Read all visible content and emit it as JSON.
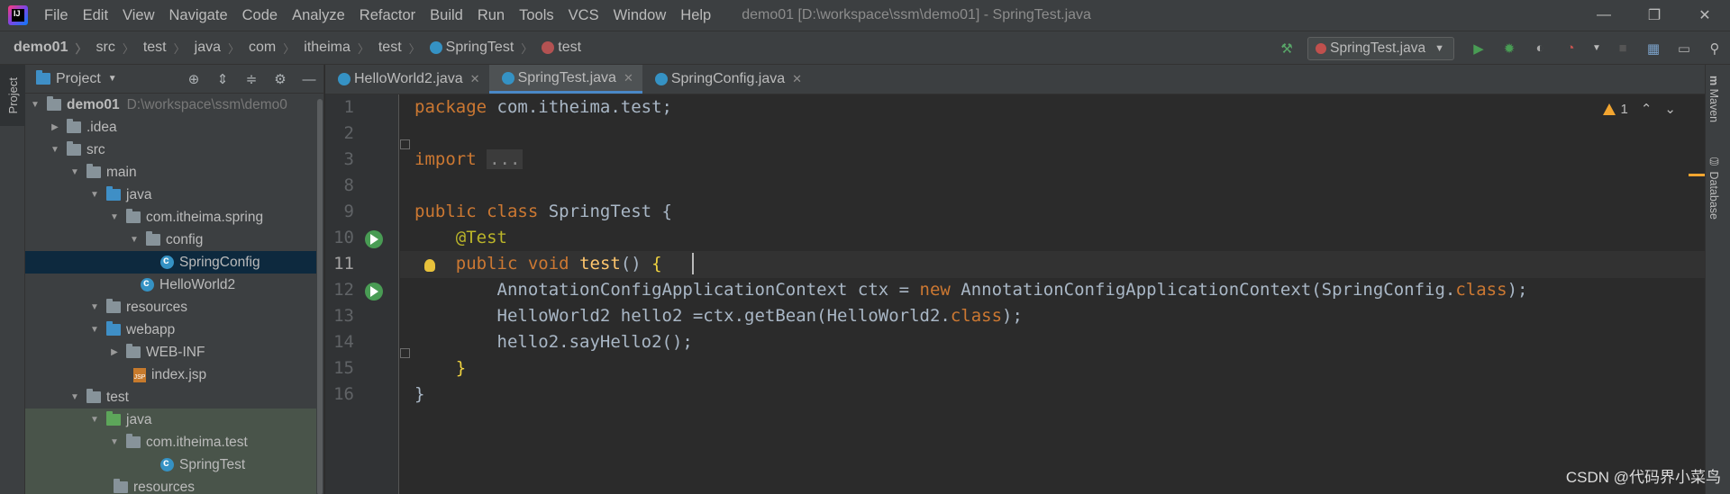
{
  "menubar": {
    "logo": "IJ",
    "items": [
      "File",
      "Edit",
      "View",
      "Navigate",
      "Code",
      "Analyze",
      "Refactor",
      "Build",
      "Run",
      "Tools",
      "VCS",
      "Window",
      "Help"
    ],
    "window_title": "demo01 [D:\\workspace\\ssm\\demo01] - SpringTest.java",
    "controls": {
      "minimize": "—",
      "restore": "❐",
      "close": "✕"
    }
  },
  "breadcrumb": {
    "items": [
      "demo01",
      "src",
      "test",
      "java",
      "com",
      "itheima",
      "test",
      "SpringTest",
      "test"
    ]
  },
  "toolbar": {
    "run_config": "SpringTest.java"
  },
  "left_stripe": {
    "project_tab": "Project"
  },
  "right_stripe": {
    "maven_tab": "Maven",
    "database_tab": "Database"
  },
  "project": {
    "title": "Project",
    "tree": [
      {
        "label": "demo01",
        "hint": "D:\\workspace\\ssm\\demo0",
        "depth": 0,
        "arrow": "down",
        "icon": "folder"
      },
      {
        "label": ".idea",
        "depth": 1,
        "arrow": "right",
        "icon": "folder"
      },
      {
        "label": "src",
        "depth": 1,
        "arrow": "down",
        "icon": "folder"
      },
      {
        "label": "main",
        "depth": 2,
        "arrow": "down",
        "icon": "folder"
      },
      {
        "label": "java",
        "depth": 3,
        "arrow": "down",
        "icon": "folder-blue"
      },
      {
        "label": "com.itheima.spring",
        "depth": 4,
        "arrow": "down",
        "icon": "folder"
      },
      {
        "label": "config",
        "depth": 5,
        "arrow": "down",
        "icon": "folder"
      },
      {
        "label": "SpringConfig",
        "depth": 6,
        "arrow": "none",
        "icon": "class"
      },
      {
        "label": "HelloWorld2",
        "depth": 5,
        "arrow": "none",
        "icon": "class"
      },
      {
        "label": "resources",
        "depth": 3,
        "arrow": "down",
        "icon": "folder"
      },
      {
        "label": "webapp",
        "depth": 3,
        "arrow": "down",
        "icon": "folder"
      },
      {
        "label": "WEB-INF",
        "depth": 4,
        "arrow": "right",
        "icon": "folder"
      },
      {
        "label": "index.jsp",
        "depth": 4,
        "arrow": "none",
        "icon": "jsp"
      },
      {
        "label": "test",
        "depth": 2,
        "arrow": "down",
        "icon": "folder"
      },
      {
        "label": "java",
        "depth": 3,
        "arrow": "down",
        "icon": "folder-green"
      },
      {
        "label": "com.itheima.test",
        "depth": 4,
        "arrow": "down",
        "icon": "folder"
      },
      {
        "label": "SpringTest",
        "depth": 5,
        "arrow": "none",
        "icon": "class"
      },
      {
        "label": "resources",
        "depth": 3,
        "arrow": "none",
        "icon": "folder"
      }
    ]
  },
  "editor": {
    "tabs": [
      {
        "label": "HelloWorld2.java",
        "active": false
      },
      {
        "label": "SpringTest.java",
        "active": true
      },
      {
        "label": "SpringConfig.java",
        "active": false
      }
    ],
    "line_numbers": [
      "1",
      "2",
      "3",
      "8",
      "9",
      "10",
      "11",
      "12",
      "13",
      "14",
      "15",
      "16"
    ],
    "current_line": "11",
    "inspection_count": "1",
    "code": {
      "l1_kw": "package",
      "l1_rest": " com.itheima.test;",
      "l3_kw": "import",
      "l3_fold": "...",
      "l9_kw": "public class",
      "l9_rest": " SpringTest {",
      "l10_an": "@Test",
      "l11_kw": "public void",
      "l11_fn": "test",
      "l11_rest": "() ",
      "l11_br": "{",
      "l12_a": "AnnotationConfigApplicationContext ctx = ",
      "l12_kw": "new",
      "l12_b": " AnnotationConfigApplicationContext(SpringConfig.",
      "l12_kw2": "class",
      "l12_c": ");",
      "l13_a": "HelloWorld2 hello2 =ctx.getBean(HelloWorld2.",
      "l13_kw": "class",
      "l13_b": ");",
      "l14": "hello2.sayHello2();",
      "l15_br": "}",
      "l16": "}"
    }
  },
  "watermark": "CSDN @代码界小菜鸟",
  "colors": {
    "keyword": "#cc7832",
    "annotation": "#bbb529",
    "function": "#ffc66d",
    "text": "#a9b7c6",
    "selection": "#0d293e"
  }
}
